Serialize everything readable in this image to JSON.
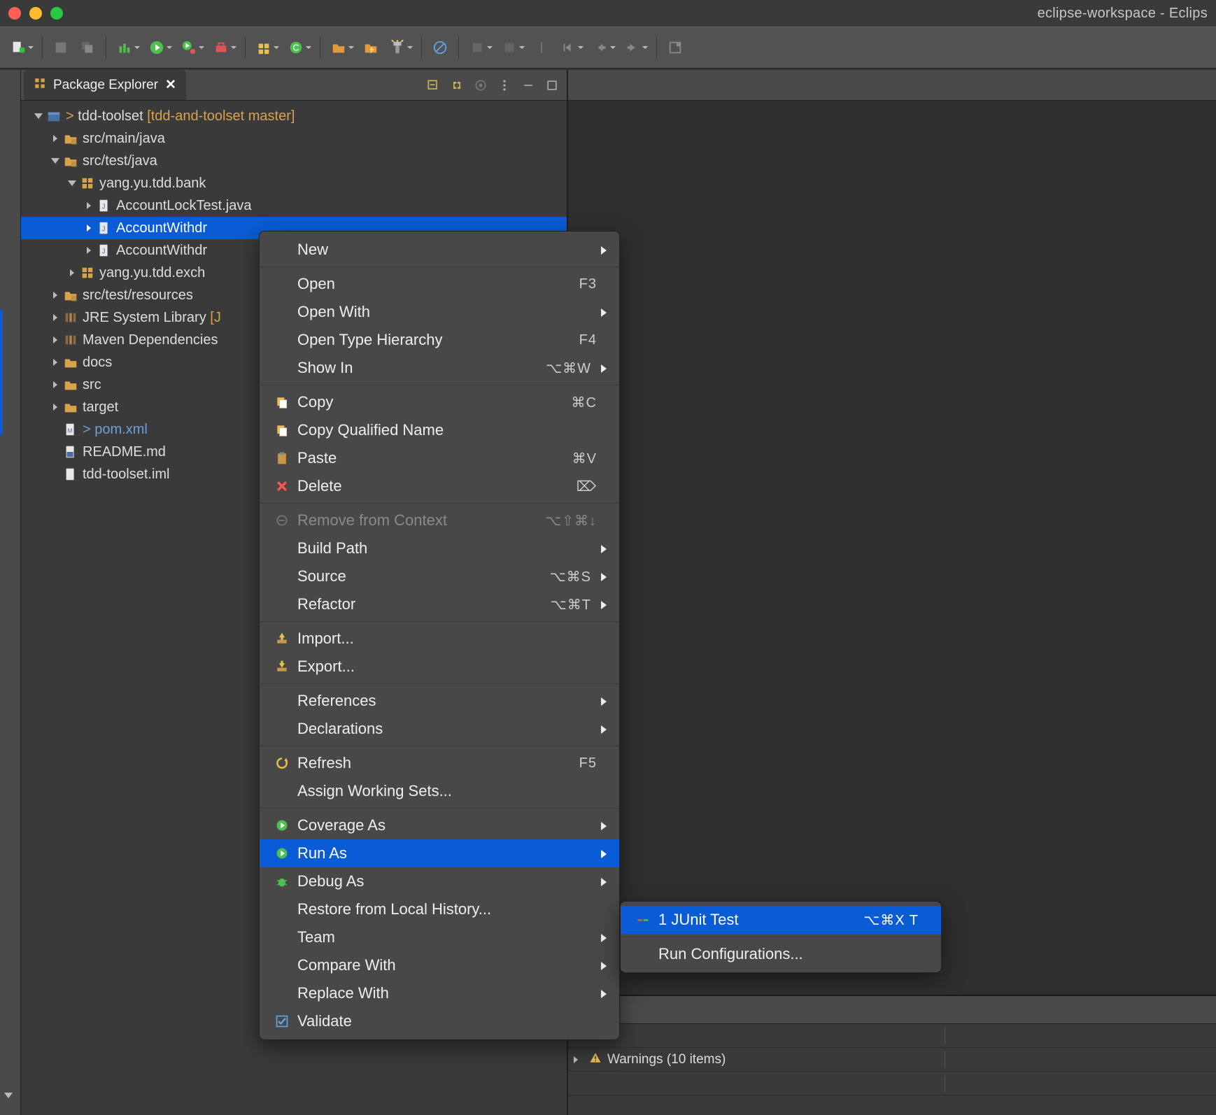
{
  "window": {
    "title": "eclipse-workspace - Eclips"
  },
  "package_explorer": {
    "tab_label": "Package Explorer"
  },
  "tree": {
    "project_prefix": "> ",
    "project_name": "tdd-toolset",
    "project_anno": " [tdd-and-toolset master]",
    "src_main_java": "src/main/java",
    "src_test_java": "src/test/java",
    "pkg_bank": "yang.yu.tdd.bank",
    "file_lock": "AccountLockTest.java",
    "file_withdraw_a": "AccountWithdr",
    "file_withdraw_b": "AccountWithdr",
    "pkg_exch": "yang.yu.tdd.exch",
    "src_test_res": "src/test/resources",
    "jre": "JRE System Library",
    "jre_anno": " [J",
    "maven": "Maven Dependencies",
    "docs": "docs",
    "src": "src",
    "target": "target",
    "pom_prefix": "> ",
    "pom": "pom.xml",
    "readme": "README.md",
    "iml": "tdd-toolset.iml"
  },
  "context_menu": {
    "new": "New",
    "open": "Open",
    "open_accel": "F3",
    "open_with": "Open With",
    "open_type_hier": "Open Type Hierarchy",
    "open_type_hier_accel": "F4",
    "show_in": "Show In",
    "show_in_accel": "⌥⌘W",
    "copy": "Copy",
    "copy_accel": "⌘C",
    "copy_qn": "Copy Qualified Name",
    "paste": "Paste",
    "paste_accel": "⌘V",
    "delete": "Delete",
    "delete_accel": "⌦",
    "remove_ctx": "Remove from Context",
    "remove_ctx_accel": "⌥⇧⌘↓",
    "build_path": "Build Path",
    "source": "Source",
    "source_accel": "⌥⌘S",
    "refactor": "Refactor",
    "refactor_accel": "⌥⌘T",
    "import": "Import...",
    "export": "Export...",
    "references": "References",
    "declarations": "Declarations",
    "refresh": "Refresh",
    "refresh_accel": "F5",
    "assign_ws": "Assign Working Sets...",
    "coverage_as": "Coverage As",
    "run_as": "Run As",
    "debug_as": "Debug As",
    "restore_lh": "Restore from Local History...",
    "team": "Team",
    "compare_with": "Compare With",
    "replace_with": "Replace With",
    "validate": "Validate"
  },
  "run_as_submenu": {
    "junit": "1 JUnit Test",
    "junit_accel": "⌥⌘X T",
    "run_configs": "Run Configurations..."
  },
  "problems": {
    "warnings_label": "Warnings (10 items)"
  }
}
